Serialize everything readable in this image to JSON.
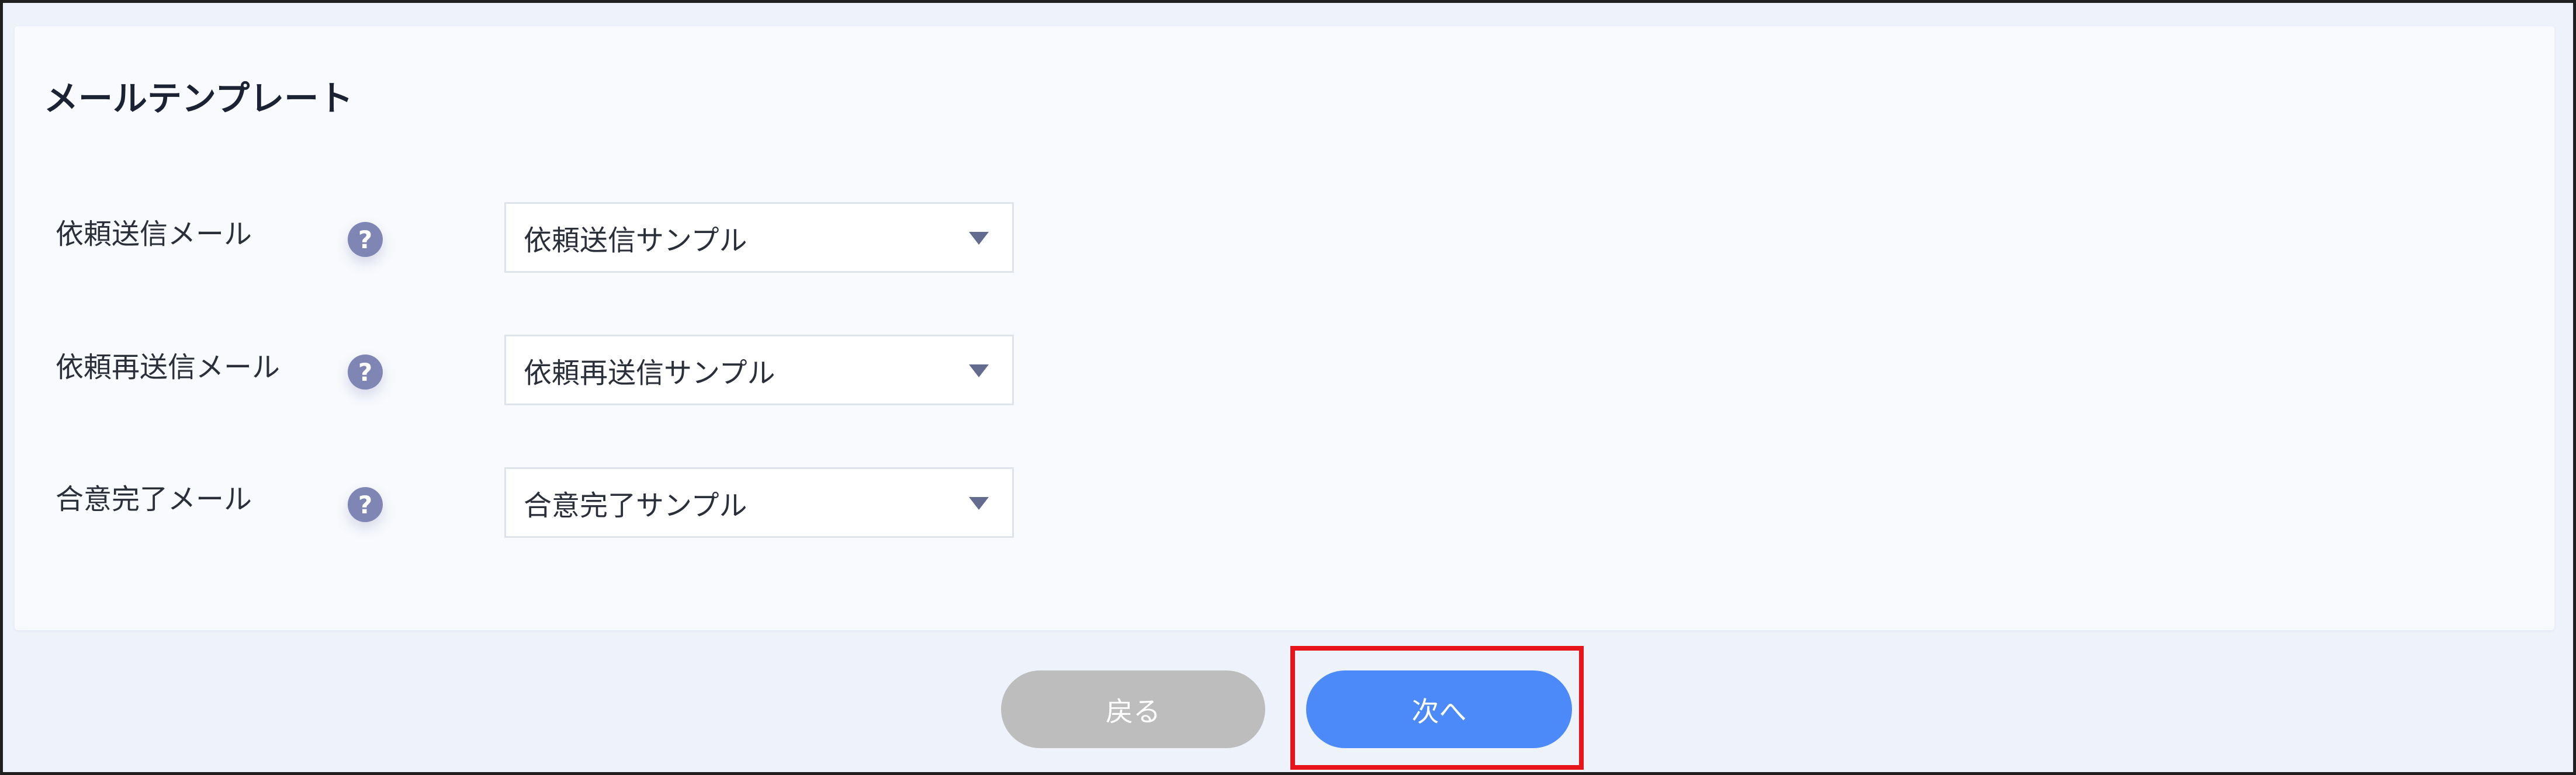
{
  "section": {
    "title": "メールテンプレート"
  },
  "rows": [
    {
      "label": "依頼送信メール",
      "help_icon": "question-icon",
      "selected": "依頼送信サンプル"
    },
    {
      "label": "依頼再送信メール",
      "help_icon": "question-icon",
      "selected": "依頼再送信サンプル"
    },
    {
      "label": "合意完了メール",
      "help_icon": "question-icon",
      "selected": "合意完了サンプル"
    }
  ],
  "help_glyph": "?",
  "buttons": {
    "back_label": "戻る",
    "next_label": "次へ"
  },
  "colors": {
    "accent": "#4b8af8",
    "disabled": "#bdbdbd",
    "help_icon": "#7f86b4",
    "highlight": "#e8141c"
  }
}
